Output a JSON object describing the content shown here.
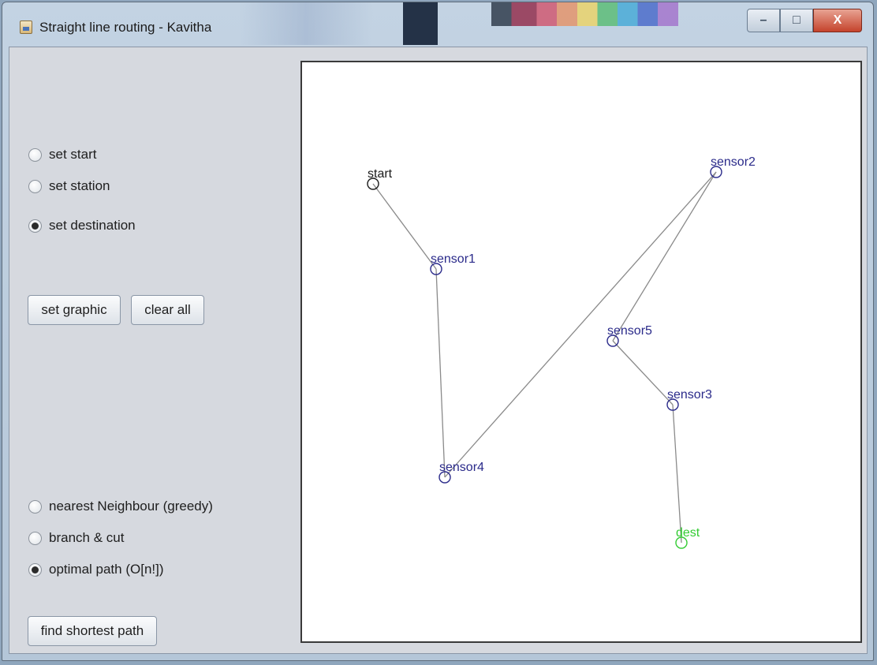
{
  "window": {
    "title": "Straight line routing - Kavitha",
    "minimize_glyph": "–",
    "maximize_glyph": "□",
    "close_glyph": "X"
  },
  "modes": [
    {
      "label": "set start",
      "checked": false
    },
    {
      "label": "set station",
      "checked": false
    },
    {
      "label": "set destination",
      "checked": true
    }
  ],
  "buttons": {
    "set_graphic": "set graphic",
    "clear_all": "clear all",
    "find_shortest_path": "find shortest path"
  },
  "algorithms": [
    {
      "label": "nearest Neighbour (greedy)",
      "checked": false
    },
    {
      "label": "branch & cut",
      "checked": false
    },
    {
      "label": "optimal path (O[n!])",
      "checked": true
    }
  ],
  "graph": {
    "colors": {
      "start": "#1a1a1a",
      "station": "#2a2a8a",
      "dest": "#33cc33",
      "edge": "#8a8a8a"
    },
    "nodes": [
      {
        "id": "start",
        "label": "start",
        "kind": "start"
      },
      {
        "id": "sensor1",
        "label": "sensor1",
        "kind": "station"
      },
      {
        "id": "sensor2",
        "label": "sensor2",
        "kind": "station"
      },
      {
        "id": "sensor3",
        "label": "sensor3",
        "kind": "station"
      },
      {
        "id": "sensor4",
        "label": "sensor4",
        "kind": "station"
      },
      {
        "id": "sensor5",
        "label": "sensor5",
        "kind": "station"
      },
      {
        "id": "dest",
        "label": "dest",
        "kind": "dest"
      }
    ],
    "edges": [
      [
        "start",
        "sensor1"
      ],
      [
        "sensor1",
        "sensor4"
      ],
      [
        "sensor4",
        "sensor2"
      ],
      [
        "sensor2",
        "sensor5"
      ],
      [
        "sensor5",
        "sensor3"
      ],
      [
        "sensor3",
        "dest"
      ]
    ]
  }
}
